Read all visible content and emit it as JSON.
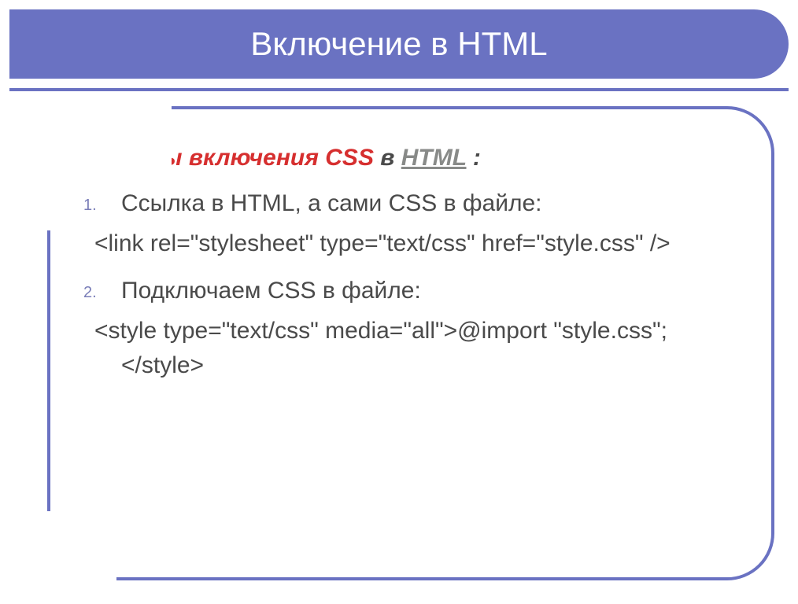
{
  "title": "Включение в HTML",
  "intro": {
    "red": "Способы включения CSS",
    "dark": " в ",
    "link": "HTML",
    "tail": " :"
  },
  "items": [
    {
      "label": "Ссылка в HTML, а сами CSS в файле:",
      "code": "<link rel=\"stylesheet\" type=\"text/css\" href=\"style.css\" />"
    },
    {
      "label": "Подключаем CSS в файле:",
      "code": "<style type=\"text/css\" media=\"all\">@import \"style.css\";</style>"
    }
  ]
}
